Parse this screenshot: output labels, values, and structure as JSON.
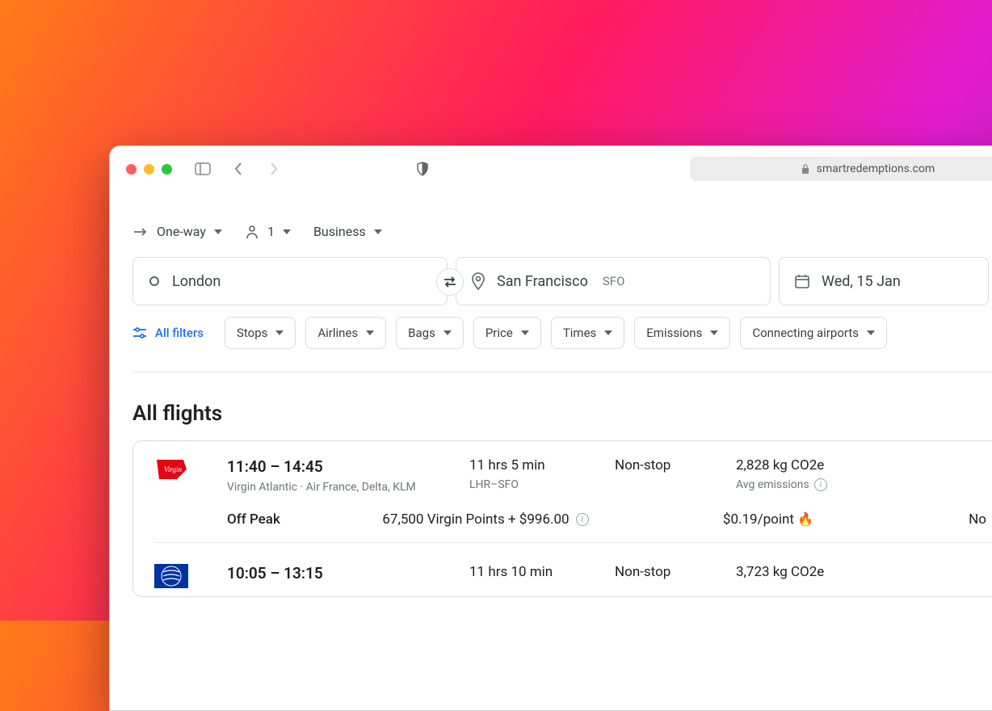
{
  "browser": {
    "url": "smartredemptions.com"
  },
  "search": {
    "trip_type": "One-way",
    "passengers": "1",
    "cabin": "Business",
    "origin": "London",
    "destination": "San Francisco",
    "destination_code": "SFO",
    "date": "Wed, 15 Jan"
  },
  "filters": {
    "all": "All filters",
    "chips": [
      "Stops",
      "Airlines",
      "Bags",
      "Price",
      "Times",
      "Emissions",
      "Connecting airports"
    ]
  },
  "results": {
    "heading": "All flights",
    "flights": [
      {
        "times": "11:40 – 14:45",
        "carriers": "Virgin Atlantic · Air France, Delta, KLM",
        "duration": "11 hrs 5 min",
        "route": "LHR–SFO",
        "stops": "Non-stop",
        "emissions": "2,828 kg CO2e",
        "emissions_note": "Avg emissions",
        "reward": {
          "peak_label": "Off Peak",
          "points_line": "67,500 Virgin Points + $996.00",
          "rate": "$0.19/point",
          "extra": "No"
        }
      },
      {
        "times": "10:05 – 13:15",
        "carriers": "",
        "duration": "11 hrs 10 min",
        "route": "",
        "stops": "Non-stop",
        "emissions": "3,723 kg CO2e",
        "emissions_note": ""
      }
    ]
  }
}
